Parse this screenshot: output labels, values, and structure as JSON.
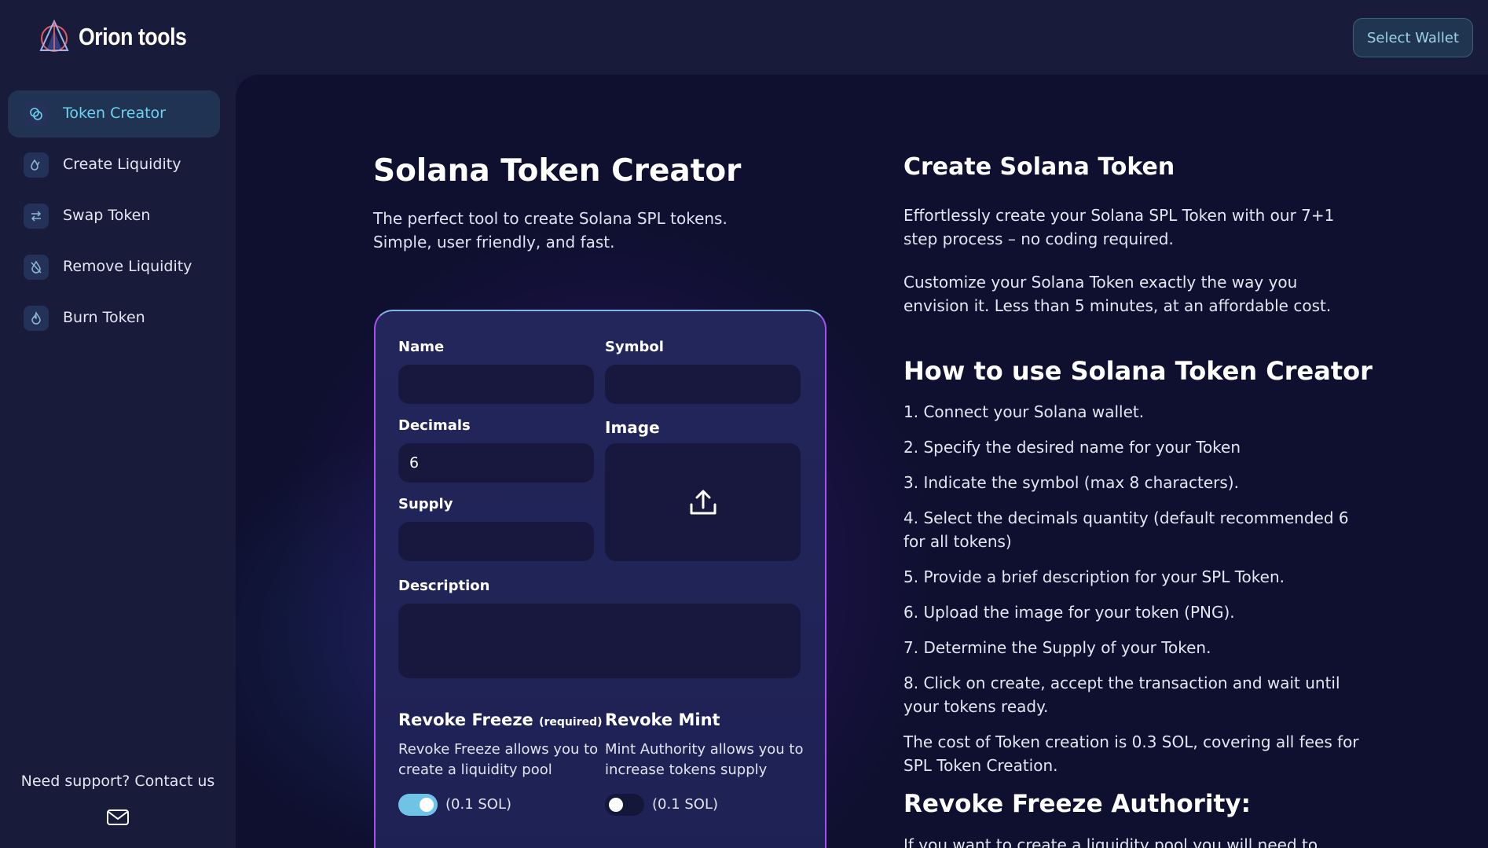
{
  "app": {
    "name": "Orion tools",
    "logo_icon": "orion-triangle-logo"
  },
  "header": {
    "wallet_button": "Select Wallet"
  },
  "sidebar": {
    "items": [
      {
        "label": "Token Creator",
        "icon": "coins-icon",
        "active": true
      },
      {
        "label": "Create Liquidity",
        "icon": "drops-icon",
        "active": false
      },
      {
        "label": "Swap Token",
        "icon": "swap-arrows-icon",
        "active": false
      },
      {
        "label": "Remove Liquidity",
        "icon": "drop-slash-icon",
        "active": false
      },
      {
        "label": "Burn Token",
        "icon": "flame-icon",
        "active": false
      }
    ],
    "support_text": "Need support? Contact us",
    "support_icon": "mail-icon"
  },
  "main": {
    "title": "Solana Token Creator",
    "intro_line1": "The perfect tool to create Solana SPL tokens.",
    "intro_line2": "Simple, user friendly, and fast."
  },
  "form": {
    "name_label": "Name",
    "name_value": "",
    "symbol_label": "Symbol",
    "symbol_value": "",
    "decimals_label": "Decimals",
    "decimals_value": "6",
    "image_label": "Image",
    "image_icon": "upload-icon",
    "supply_label": "Supply",
    "supply_value": "",
    "description_label": "Description",
    "description_value": "",
    "revoke_freeze_title": "Revoke Freeze",
    "revoke_freeze_required": "(required)",
    "revoke_freeze_desc": "Revoke Freeze allows you to create a liquidity pool",
    "revoke_freeze_cost": "(0.1 SOL)",
    "revoke_freeze_enabled": true,
    "revoke_mint_title": "Revoke Mint",
    "revoke_mint_desc": "Mint Authority allows you to increase tokens supply",
    "revoke_mint_cost": "(0.1 SOL)",
    "revoke_mint_enabled": false
  },
  "info": {
    "create_title": "Create Solana Token",
    "create_p1": "Effortlessly create your Solana SPL Token with our 7+1 step process – no coding required.",
    "create_p2": "Customize your Solana Token exactly the way you envision it. Less than 5 minutes, at an affordable cost.",
    "howto_title": "How to use Solana Token Creator",
    "steps": [
      "1. Connect your Solana wallet.",
      "2. Specify the desired name for your Token",
      "3. Indicate the symbol (max 8 characters).",
      "4. Select the decimals quantity (default recommended 6 for all tokens)",
      "5. Provide a brief description for your SPL Token.",
      "6. Upload the image for your token (PNG).",
      "7. Determine the Supply of your Token.",
      "8. Click on create, accept the transaction and wait until your tokens ready."
    ],
    "cost_text": "The cost of Token creation is 0.3 SOL, covering all fees for SPL Token Creation.",
    "freeze_title": "Revoke Freeze Authority:",
    "freeze_text": "If you want to create a liquidity pool you will need to"
  },
  "colors": {
    "accent": "#6bd3ee",
    "card_border": "#a84ff0",
    "background": "#0f1030"
  }
}
